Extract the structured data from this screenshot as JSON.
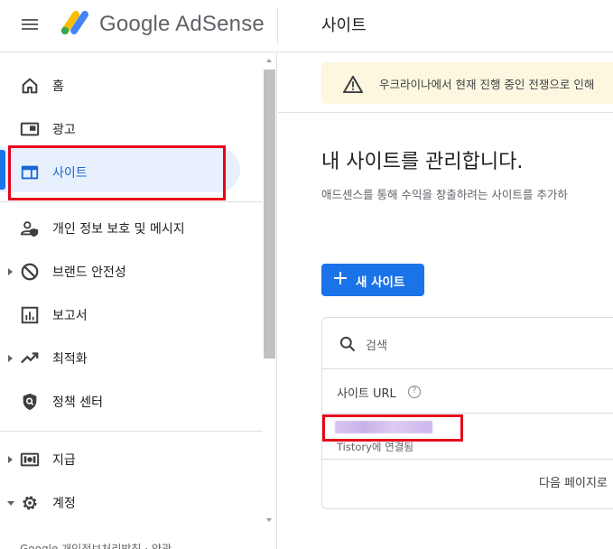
{
  "header": {
    "app_name": "Google AdSense",
    "page_title": "사이트"
  },
  "sidebar": {
    "items": [
      {
        "label": "홈",
        "icon": "home-icon"
      },
      {
        "label": "광고",
        "icon": "ads-icon"
      },
      {
        "label": "사이트",
        "icon": "sites-icon",
        "active": true
      },
      {
        "label": "개인 정보 보호 및 메시지",
        "icon": "privacy-messaging-icon"
      },
      {
        "label": "브랜드 안전성",
        "icon": "block-icon",
        "expandable": true
      },
      {
        "label": "보고서",
        "icon": "reports-icon"
      },
      {
        "label": "최적화",
        "icon": "trending-up-icon",
        "expandable": true
      },
      {
        "label": "정책 센터",
        "icon": "policy-shield-icon"
      },
      {
        "label": "지급",
        "icon": "payments-icon",
        "expandable": true
      },
      {
        "label": "계정",
        "icon": "settings-gear-icon",
        "expanded": true
      }
    ],
    "footer_text": "Google 개인정보처리방침 · 약관"
  },
  "banner": {
    "icon": "warning-icon",
    "text": "우크라이나에서 현재 진행 중인 전쟁으로 인해"
  },
  "main": {
    "heading": "내 사이트를 관리합니다.",
    "description": "애드센스를 통해 수익을 창출하려는 사이트를 추가하",
    "new_site_button": "새 사이트",
    "search_placeholder": "검색",
    "column_header": "사이트 URL",
    "help_icon": "?",
    "site_sub_text": "Tistory에 연결됨",
    "pager_text": "다음 페이지로"
  },
  "colors": {
    "accent": "#1a73e8",
    "highlight_box": "#e8001c",
    "banner_bg": "#fef7e0",
    "active_bg": "#e8f0fe"
  }
}
